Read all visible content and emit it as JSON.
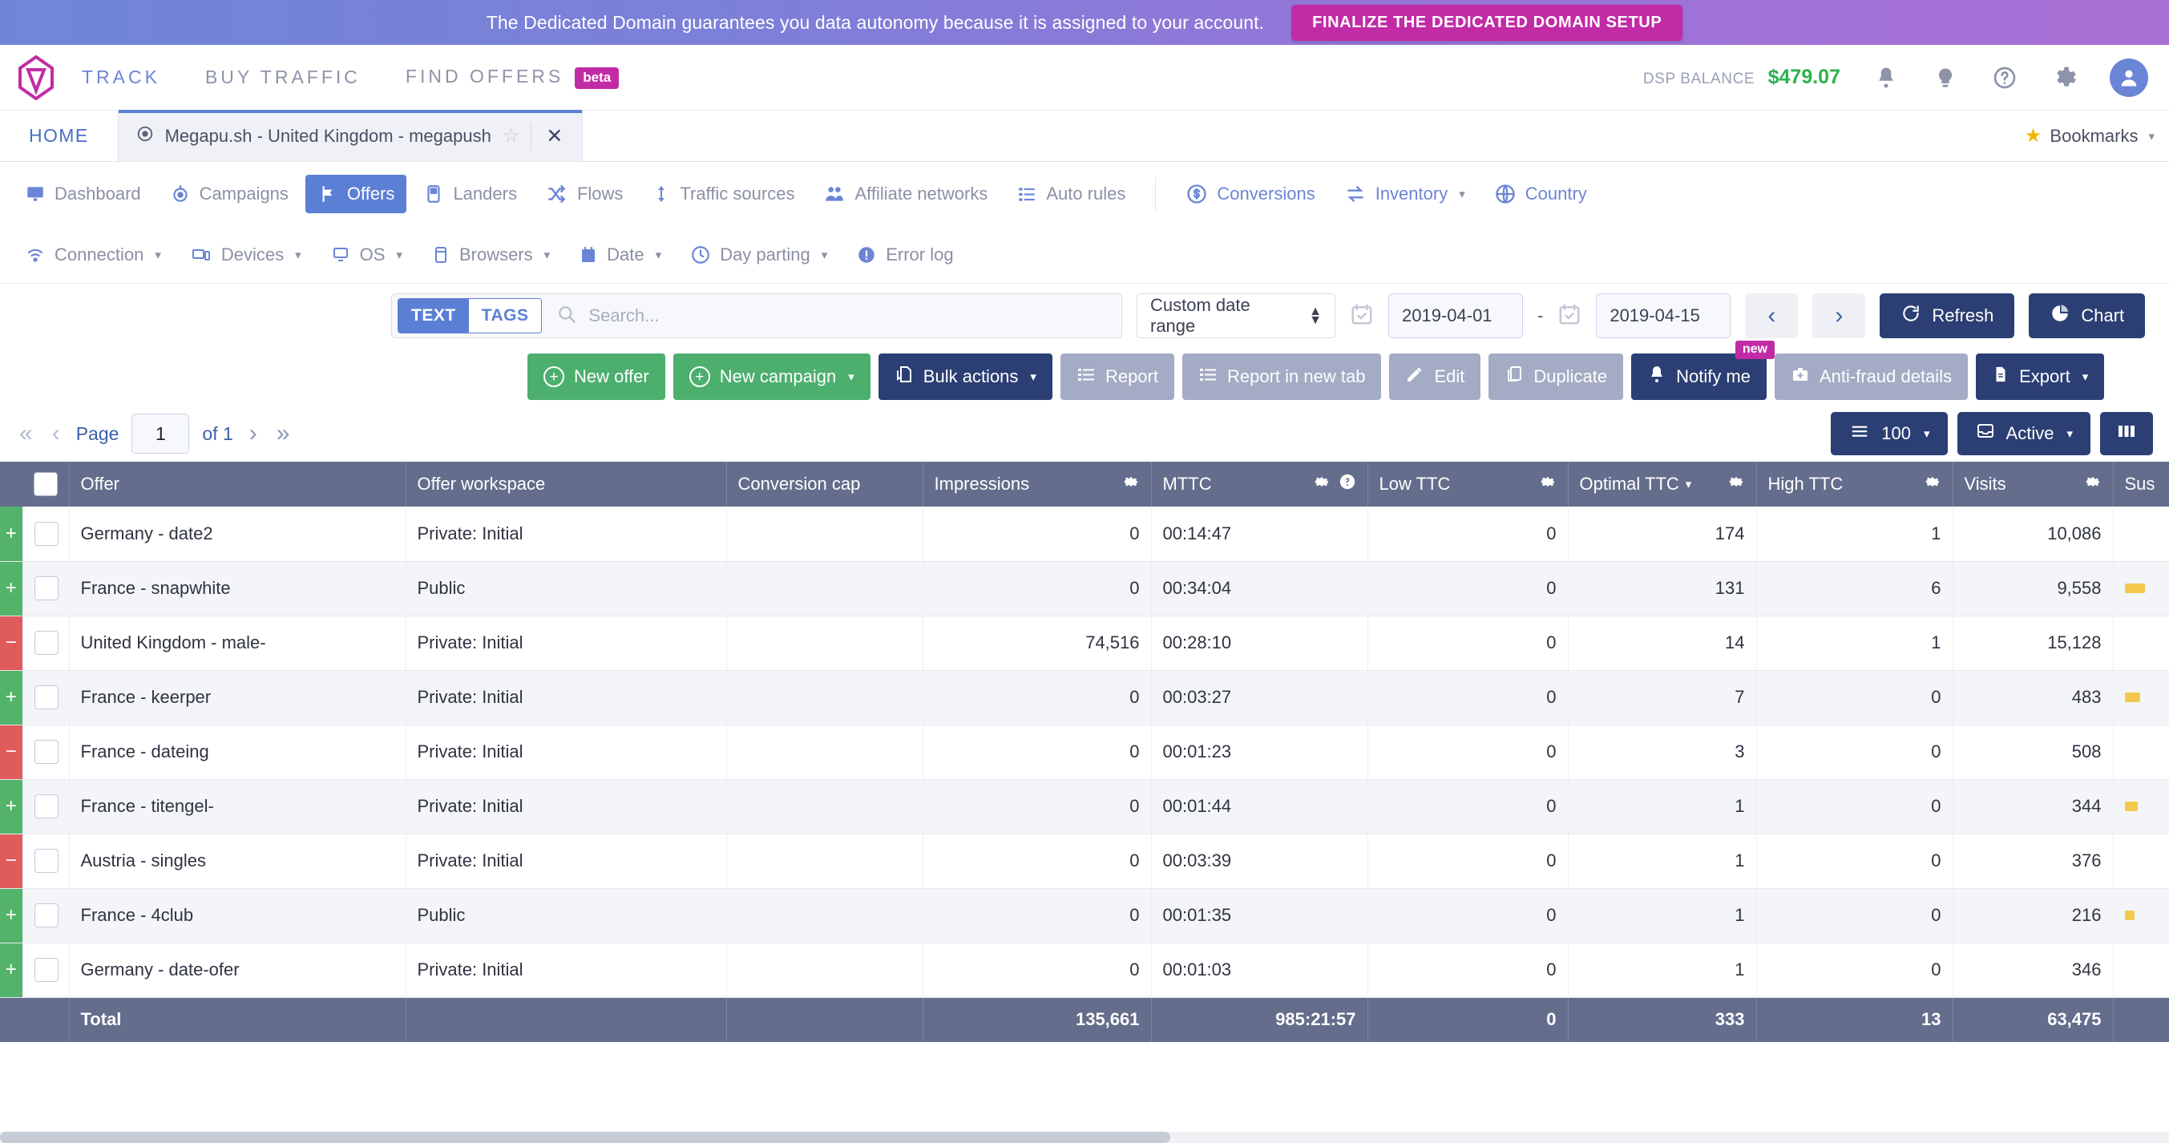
{
  "promo": {
    "text": "The Dedicated Domain guarantees you data autonomy because it is assigned to your account.",
    "button": "FINALIZE THE DEDICATED DOMAIN SETUP"
  },
  "header": {
    "nav": [
      {
        "label": "TRACK",
        "active": true,
        "badge": ""
      },
      {
        "label": "BUY TRAFFIC",
        "active": false,
        "badge": ""
      },
      {
        "label": "FIND OFFERS",
        "active": false,
        "badge": "beta"
      }
    ],
    "balance_label": "DSP BALANCE",
    "balance_value": "$479.07"
  },
  "tabs": {
    "home": "HOME",
    "doc_title": "Megapu.sh - United Kingdom - megapush",
    "bookmarks": "Bookmarks"
  },
  "nav_primary": [
    {
      "label": "Dashboard",
      "icon": "dashboard-icon",
      "selected": false,
      "caret": false
    },
    {
      "label": "Campaigns",
      "icon": "target-icon",
      "selected": false,
      "caret": false
    },
    {
      "label": "Offers",
      "icon": "flag-icon",
      "selected": true,
      "caret": false
    },
    {
      "label": "Landers",
      "icon": "lander-icon",
      "selected": false,
      "caret": false
    },
    {
      "label": "Flows",
      "icon": "shuffle-icon",
      "selected": false,
      "caret": false
    },
    {
      "label": "Traffic sources",
      "icon": "traffic-icon",
      "selected": false,
      "caret": false
    },
    {
      "label": "Affiliate networks",
      "icon": "people-icon",
      "selected": false,
      "caret": false
    },
    {
      "label": "Auto rules",
      "icon": "list-icon",
      "selected": false,
      "caret": false
    },
    {
      "label": "Conversions",
      "icon": "dollar-icon",
      "selected": false,
      "caret": false
    },
    {
      "label": "Inventory",
      "icon": "exchange-icon",
      "selected": false,
      "caret": true
    },
    {
      "label": "Country",
      "icon": "globe-icon",
      "selected": false,
      "caret": false
    }
  ],
  "nav_secondary": [
    {
      "label": "Connection",
      "icon": "wifi-icon",
      "caret": true
    },
    {
      "label": "Devices",
      "icon": "devices-icon",
      "caret": true
    },
    {
      "label": "OS",
      "icon": "monitor-icon",
      "caret": true
    },
    {
      "label": "Browsers",
      "icon": "browser-icon",
      "caret": true
    },
    {
      "label": "Date",
      "icon": "calendar-icon",
      "caret": true
    },
    {
      "label": "Day parting",
      "icon": "clock-icon",
      "caret": true
    },
    {
      "label": "Error log",
      "icon": "alert-icon",
      "caret": false
    }
  ],
  "filters": {
    "seg_text": "TEXT",
    "seg_tags": "TAGS",
    "search_placeholder": "Search...",
    "search_value": "",
    "date_range_label": "Custom date range",
    "date_from": "2019-04-01",
    "date_to": "2019-04-15",
    "dash": "-",
    "prev": "‹",
    "next": "›",
    "refresh": "Refresh",
    "chart": "Chart"
  },
  "actions": [
    {
      "label": "New offer",
      "style": "green",
      "icon": "plus-circle-icon",
      "caret": false,
      "badge": ""
    },
    {
      "label": "New campaign",
      "style": "green",
      "icon": "plus-circle-icon",
      "caret": true,
      "badge": ""
    },
    {
      "label": "Bulk actions",
      "style": "navy",
      "icon": "bulk-icon",
      "caret": true,
      "badge": ""
    },
    {
      "label": "Report",
      "style": "grey",
      "icon": "list-icon",
      "caret": false,
      "badge": ""
    },
    {
      "label": "Report in new tab",
      "style": "grey",
      "icon": "list-icon",
      "caret": false,
      "badge": ""
    },
    {
      "label": "Edit",
      "style": "grey",
      "icon": "pencil-icon",
      "caret": false,
      "badge": ""
    },
    {
      "label": "Duplicate",
      "style": "grey",
      "icon": "copy-icon",
      "caret": false,
      "badge": ""
    },
    {
      "label": "Notify me",
      "style": "navy",
      "icon": "bell-icon",
      "caret": false,
      "badge": "new"
    },
    {
      "label": "Anti-fraud details",
      "style": "grey",
      "icon": "briefcase-icon",
      "caret": false,
      "badge": ""
    },
    {
      "label": "Export",
      "style": "navy",
      "icon": "file-icon",
      "caret": true,
      "badge": ""
    }
  ],
  "pagination": {
    "first": "«",
    "prev": "‹",
    "page_label": "Page",
    "page_value": "1",
    "of_label": "of 1",
    "next": "›",
    "last": "»",
    "rows_per_page": "100",
    "status_filter": "Active"
  },
  "table": {
    "columns": [
      {
        "label": "Offer",
        "align": "left",
        "gear": false,
        "help": false,
        "caret": false
      },
      {
        "label": "Offer workspace",
        "align": "left",
        "gear": false,
        "help": false,
        "caret": false
      },
      {
        "label": "Conversion cap",
        "align": "left",
        "gear": false,
        "help": false,
        "caret": false
      },
      {
        "label": "Impressions",
        "align": "left",
        "gear": true,
        "help": false,
        "caret": false
      },
      {
        "label": "MTTC",
        "align": "left",
        "gear": true,
        "help": true,
        "caret": false
      },
      {
        "label": "Low TTC",
        "align": "left",
        "gear": true,
        "help": false,
        "caret": false
      },
      {
        "label": "Optimal TTC",
        "align": "left",
        "gear": true,
        "help": false,
        "caret": true
      },
      {
        "label": "High TTC",
        "align": "left",
        "gear": true,
        "help": false,
        "caret": false
      },
      {
        "label": "Visits",
        "align": "left",
        "gear": true,
        "help": false,
        "caret": false
      },
      {
        "label": "Sus",
        "align": "left",
        "gear": false,
        "help": false,
        "caret": false
      }
    ],
    "rows": [
      {
        "status": "green",
        "sign": "+",
        "offer": "Germany - date2",
        "workspace": "Private: Initial",
        "conversion_cap": "",
        "impressions": "0",
        "mttc": "00:14:47",
        "low_ttc": "0",
        "optimal_ttc": "174",
        "high_ttc": "1",
        "visits": "10,086",
        "sus_bar": 0
      },
      {
        "status": "green",
        "sign": "+",
        "offer": "France - snapwhite",
        "workspace": "Public",
        "conversion_cap": "",
        "impressions": "0",
        "mttc": "00:34:04",
        "low_ttc": "0",
        "optimal_ttc": "131",
        "high_ttc": "6",
        "visits": "9,558",
        "sus_bar": 62
      },
      {
        "status": "red",
        "sign": "−",
        "offer": "United Kingdom - male-",
        "workspace": "Private: Initial",
        "conversion_cap": "",
        "impressions": "74,516",
        "mttc": "00:28:10",
        "low_ttc": "0",
        "optimal_ttc": "14",
        "high_ttc": "1",
        "visits": "15,128",
        "sus_bar": 0
      },
      {
        "status": "green",
        "sign": "+",
        "offer": "France - keerper",
        "workspace": "Private: Initial",
        "conversion_cap": "",
        "impressions": "0",
        "mttc": "00:03:27",
        "low_ttc": "0",
        "optimal_ttc": "7",
        "high_ttc": "0",
        "visits": "483",
        "sus_bar": 48
      },
      {
        "status": "red",
        "sign": "−",
        "offer": "France - dateing",
        "workspace": "Private: Initial",
        "conversion_cap": "",
        "impressions": "0",
        "mttc": "00:01:23",
        "low_ttc": "0",
        "optimal_ttc": "3",
        "high_ttc": "0",
        "visits": "508",
        "sus_bar": 0
      },
      {
        "status": "green",
        "sign": "+",
        "offer": "France - titengel-",
        "workspace": "Private: Initial",
        "conversion_cap": "",
        "impressions": "0",
        "mttc": "00:01:44",
        "low_ttc": "0",
        "optimal_ttc": "1",
        "high_ttc": "0",
        "visits": "344",
        "sus_bar": 40
      },
      {
        "status": "red",
        "sign": "−",
        "offer": "Austria - singles",
        "workspace": "Private: Initial",
        "conversion_cap": "",
        "impressions": "0",
        "mttc": "00:03:39",
        "low_ttc": "0",
        "optimal_ttc": "1",
        "high_ttc": "0",
        "visits": "376",
        "sus_bar": 0
      },
      {
        "status": "green",
        "sign": "+",
        "offer": "France - 4club",
        "workspace": "Public",
        "conversion_cap": "",
        "impressions": "0",
        "mttc": "00:01:35",
        "low_ttc": "0",
        "optimal_ttc": "1",
        "high_ttc": "0",
        "visits": "216",
        "sus_bar": 30
      },
      {
        "status": "green",
        "sign": "+",
        "offer": "Germany - date-ofer",
        "workspace": "Private: Initial",
        "conversion_cap": "",
        "impressions": "0",
        "mttc": "00:01:03",
        "low_ttc": "0",
        "optimal_ttc": "1",
        "high_ttc": "0",
        "visits": "346",
        "sus_bar": 0
      }
    ],
    "total": {
      "label": "Total",
      "workspace": "",
      "conversion_cap": "",
      "impressions": "135,661",
      "mttc": "985:21:57",
      "low_ttc": "0",
      "optimal_ttc": "333",
      "high_ttc": "13",
      "visits": "63,475",
      "sus": ""
    }
  },
  "colors": {
    "brand_magenta": "#c22ba6",
    "accent_blue": "#5b7fd4",
    "navy": "#2c3f74",
    "green": "#4caf6e",
    "balance_green": "#2bb24c",
    "header_slate": "#646d8c",
    "status_green": "#54b36a",
    "status_red": "#e05c5c",
    "bar_yellow": "#f2c94c"
  }
}
